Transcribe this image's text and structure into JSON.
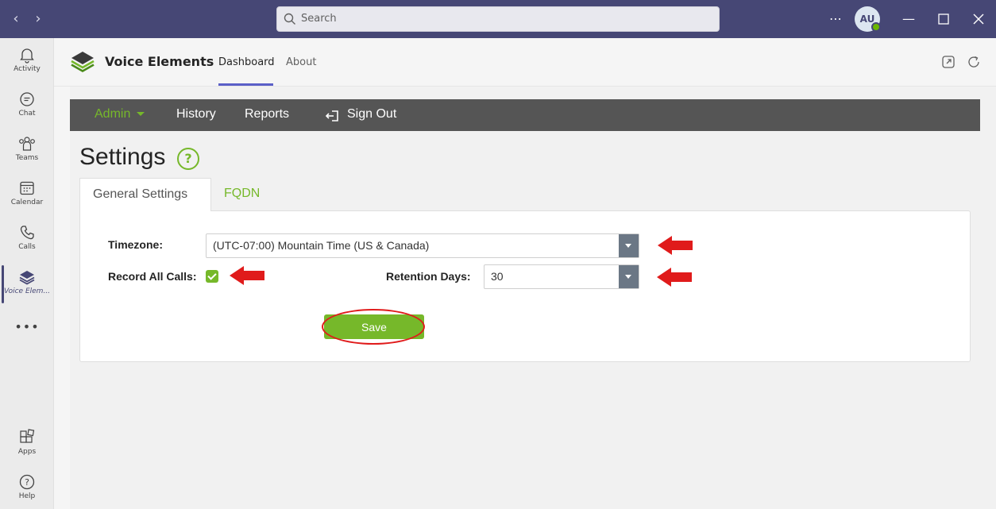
{
  "titlebar": {
    "search_placeholder": "Search",
    "avatar_initials": "AU"
  },
  "rail": {
    "items": [
      {
        "label": "Activity",
        "icon": "bell-icon"
      },
      {
        "label": "Chat",
        "icon": "chat-icon"
      },
      {
        "label": "Teams",
        "icon": "teams-icon"
      },
      {
        "label": "Calendar",
        "icon": "calendar-icon"
      },
      {
        "label": "Calls",
        "icon": "phone-icon"
      },
      {
        "label": "Voice Elem...",
        "icon": "voice-elements-icon"
      }
    ],
    "bottom": [
      {
        "label": "Apps",
        "icon": "apps-icon"
      },
      {
        "label": "Help",
        "icon": "help-icon"
      }
    ]
  },
  "app": {
    "name": "Voice Elements",
    "tabs": [
      {
        "label": "Dashboard",
        "active": true
      },
      {
        "label": "About",
        "active": false
      }
    ]
  },
  "menubar": {
    "admin": "Admin",
    "history": "History",
    "reports": "Reports",
    "signout": "Sign Out"
  },
  "page": {
    "title": "Settings",
    "help_glyph": "?",
    "tabs": [
      {
        "label": "General Settings",
        "active": true
      },
      {
        "label": "FQDN",
        "active": false
      }
    ]
  },
  "form": {
    "timezone_label": "Timezone:",
    "timezone_value": "(UTC-07:00) Mountain Time (US & Canada)",
    "record_label": "Record All Calls:",
    "record_checked": true,
    "retention_label": "Retention Days:",
    "retention_value": "30",
    "save_label": "Save"
  },
  "colors": {
    "titlebar": "#464775",
    "accent_green": "#76b82a",
    "menubar": "#555555",
    "annotation_red": "#e01b1b"
  }
}
